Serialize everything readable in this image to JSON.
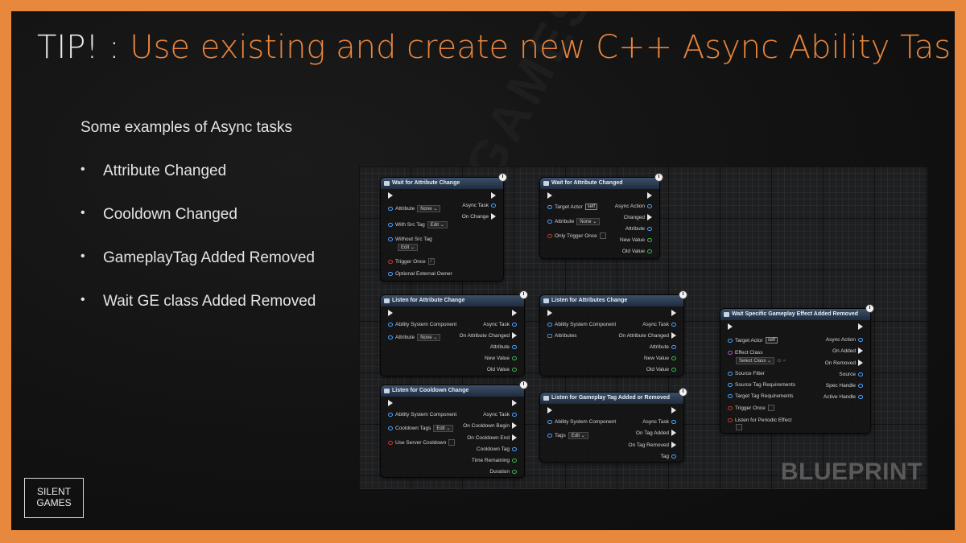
{
  "slide": {
    "title_prefix": "TIP! : ",
    "title_main": "Use existing and create new C++ Async Ability Tasks",
    "intro": "Some examples of Async tasks",
    "bullets": [
      "Attribute Changed",
      "Cooldown Changed",
      "GameplayTag Added Removed",
      "Wait GE class Added Removed"
    ],
    "watermark": "SILENT GAMES",
    "logo_line1": "SILENT",
    "logo_line2": "GAMES",
    "accent_color": "#e8843c",
    "border_color": "#e8883c"
  },
  "blueprint": {
    "label": "BLUEPRINT",
    "nodes": {
      "n1": {
        "title": "Wait for Attribute Change",
        "left": [
          {
            "label": "Attribute",
            "dropdown": "None"
          },
          {
            "label": "With Src Tag",
            "dropdown": "Edit"
          },
          {
            "label": "Without Src Tag",
            "dropdown": "Edit"
          },
          {
            "label": "Trigger Once",
            "checked": "✓"
          },
          {
            "label": "Optional External Owner"
          }
        ],
        "right": [
          "Async Task",
          "On Change"
        ]
      },
      "n2": {
        "title": "Wait for Attribute Changed",
        "left": [
          {
            "label": "Target Actor",
            "value": "self"
          },
          {
            "label": "Attribute",
            "dropdown": "None"
          },
          {
            "label": "Only Trigger Once"
          }
        ],
        "right": [
          "Async Action",
          "Changed",
          "Attribute",
          "New Value",
          "Old Value"
        ]
      },
      "n3": {
        "title": "Listen for Attribute Change",
        "left": [
          {
            "label": "Ability System Component"
          },
          {
            "label": "Attribute",
            "dropdown": "None"
          }
        ],
        "right": [
          "Async Task",
          "On Attribute Changed",
          "Attribute",
          "New Value",
          "Old Value"
        ]
      },
      "n4": {
        "title": "Listen for Attributes Change",
        "left": [
          {
            "label": "Ability System Component"
          },
          {
            "label": "Attributes"
          }
        ],
        "right": [
          "Async Task",
          "On Attribute Changed",
          "Attribute",
          "New Value",
          "Old Value"
        ]
      },
      "n5": {
        "title": "Listen for Cooldown Change",
        "left": [
          {
            "label": "Ability System Component"
          },
          {
            "label": "Cooldown Tags",
            "dropdown": "Edit"
          },
          {
            "label": "Use Server Cooldown"
          }
        ],
        "right": [
          "Async Task",
          "On Cooldown Begin",
          "On Cooldown End",
          "Cooldown Tag",
          "Time Remaining",
          "Duration"
        ]
      },
      "n6": {
        "title": "Listen for Gameplay Tag Added or Removed",
        "left": [
          {
            "label": "Ability System Component"
          },
          {
            "label": "Tags",
            "dropdown": "Edit"
          }
        ],
        "right": [
          "Async Task",
          "On Tag Added",
          "On Tag Removed",
          "Tag"
        ]
      },
      "n7": {
        "title": "Wait Specific Gameplay Effect Added Removed",
        "left": [
          {
            "label": "Target Actor",
            "value": "self"
          },
          {
            "label": "Effect Class",
            "dropdown": "Select Class"
          },
          {
            "label": "Source Filter"
          },
          {
            "label": "Source Tag Requirements"
          },
          {
            "label": "Target Tag Requirements"
          },
          {
            "label": "Trigger Once"
          },
          {
            "label": "Listen for Periodic Effect"
          }
        ],
        "right": [
          "Async Action",
          "On Added",
          "On Removed",
          "Source",
          "Spec Handle",
          "Active Handle"
        ]
      }
    }
  }
}
